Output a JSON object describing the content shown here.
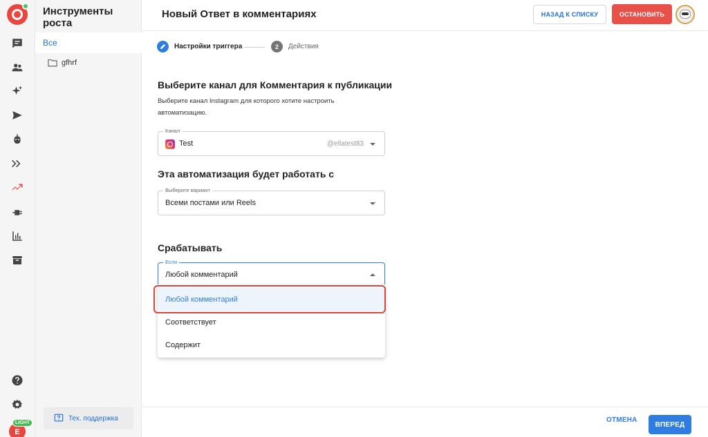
{
  "rail": {
    "items": [
      {
        "icon": "chat-icon"
      },
      {
        "icon": "users-icon"
      },
      {
        "icon": "sparkles-icon"
      },
      {
        "icon": "send-icon"
      },
      {
        "icon": "bot-icon"
      },
      {
        "icon": "flows-icon"
      },
      {
        "icon": "growth-trend-icon",
        "active": true
      },
      {
        "icon": "integrations-icon"
      },
      {
        "icon": "analytics-icon"
      },
      {
        "icon": "archive-icon"
      }
    ],
    "help_icon": "help-icon",
    "settings_icon": "settings-icon",
    "avatar_letter": "E",
    "plan_badge": "LIGHT"
  },
  "sidebar": {
    "title": "Инструменты роста",
    "all_label": "Все",
    "folders": [
      {
        "name": "gfhrf"
      }
    ],
    "support_label": "Тех. поддержка"
  },
  "header": {
    "title": "Новый Ответ в комментариях",
    "back_label": "НАЗАД К СПИСКУ",
    "stop_label": "ОСТАНОВИТЬ"
  },
  "stepper": {
    "step1_label": "Настройки триггера",
    "step2_number": "2",
    "step2_label": "Действия"
  },
  "channel_section": {
    "heading": "Выберите канал для Комментария к публикации",
    "description": "Выберите канал Instagram для которого хотите настроить автоматизацию.",
    "field_label": "Канал",
    "value": "Test",
    "account": "@ellatest83"
  },
  "scope_section": {
    "heading": "Эта автоматизация будет работать с",
    "field_label": "Выберите вариант",
    "value": "Всеми постами или Reels"
  },
  "trigger_section": {
    "heading": "Срабатывать",
    "field_label": "Если",
    "value": "Любой комментарий",
    "options": [
      "Любой комментарий",
      "Соответствует",
      "Содержит"
    ],
    "selected_index": 0
  },
  "footer": {
    "cancel_label": "ОТМЕНА",
    "next_label": "ВПЕРЕД"
  },
  "colors": {
    "accent": "#2f7de1",
    "brand_red": "#e8463f",
    "highlight": "#d8453e"
  }
}
